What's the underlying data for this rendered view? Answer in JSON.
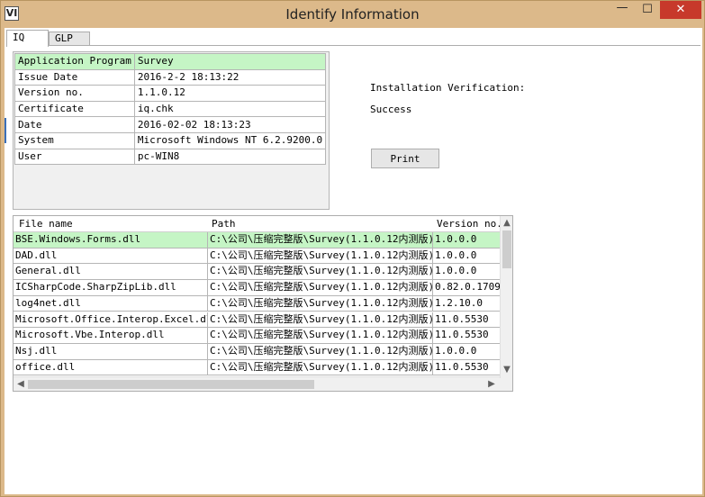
{
  "window": {
    "icon_glyph": "VI",
    "title": "Identify Information",
    "minimize_glyph": "—",
    "maximize_glyph": "☐",
    "close_glyph": "✕"
  },
  "tabs": [
    {
      "label": "IQ",
      "active": true
    },
    {
      "label": "GLP",
      "active": false
    }
  ],
  "info_table": [
    {
      "key": "Application Program",
      "value": "Survey",
      "selected": true
    },
    {
      "key": "Issue Date",
      "value": "2016-2-2 18:13:22"
    },
    {
      "key": "Version no.",
      "value": "1.1.0.12"
    },
    {
      "key": "Certificate",
      "value": "iq.chk"
    },
    {
      "key": "Date",
      "value": "2016-02-02 18:13:23"
    },
    {
      "key": "System",
      "value": "Microsoft Windows NT 6.2.9200.0"
    },
    {
      "key": "User",
      "value": "pc-WIN8"
    }
  ],
  "verification": {
    "label": "Installation Verification:",
    "value": "Success"
  },
  "print_button": "Print",
  "files_grid": {
    "columns": {
      "file": "File name",
      "path": "Path",
      "version": "Version no."
    },
    "rows": [
      {
        "file": "BSE.Windows.Forms.dll",
        "path": "C:\\公司\\压缩完整版\\Survey(1.1.0.12内测版)",
        "version": "1.0.0.0",
        "selected": true
      },
      {
        "file": "DAD.dll",
        "path": "C:\\公司\\压缩完整版\\Survey(1.1.0.12内测版)",
        "version": "1.0.0.0"
      },
      {
        "file": "General.dll",
        "path": "C:\\公司\\压缩完整版\\Survey(1.1.0.12内测版)",
        "version": "1.0.0.0"
      },
      {
        "file": "ICSharpCode.SharpZipLib.dll",
        "path": "C:\\公司\\压缩完整版\\Survey(1.1.0.12内测版)",
        "version": "0.82.0.1709"
      },
      {
        "file": "log4net.dll",
        "path": "C:\\公司\\压缩完整版\\Survey(1.1.0.12内测版)",
        "version": "1.2.10.0"
      },
      {
        "file": "Microsoft.Office.Interop.Excel.dll",
        "path": "C:\\公司\\压缩完整版\\Survey(1.1.0.12内测版)",
        "version": "11.0.5530"
      },
      {
        "file": "Microsoft.Vbe.Interop.dll",
        "path": "C:\\公司\\压缩完整版\\Survey(1.1.0.12内测版)",
        "version": "11.0.5530"
      },
      {
        "file": "Nsj.dll",
        "path": "C:\\公司\\压缩完整版\\Survey(1.1.0.12内测版)",
        "version": "1.0.0.0"
      },
      {
        "file": "office.dll",
        "path": "C:\\公司\\压缩完整版\\Survey(1.1.0.12内测版)",
        "version": "11.0.5530"
      }
    ]
  },
  "scroll_glyphs": {
    "up": "▲",
    "down": "▼",
    "left": "◀",
    "right": "▶"
  },
  "colors": {
    "window_frame": "#dcb98a",
    "selection_green": "#c5f5c5",
    "close_red": "#c7392b"
  }
}
